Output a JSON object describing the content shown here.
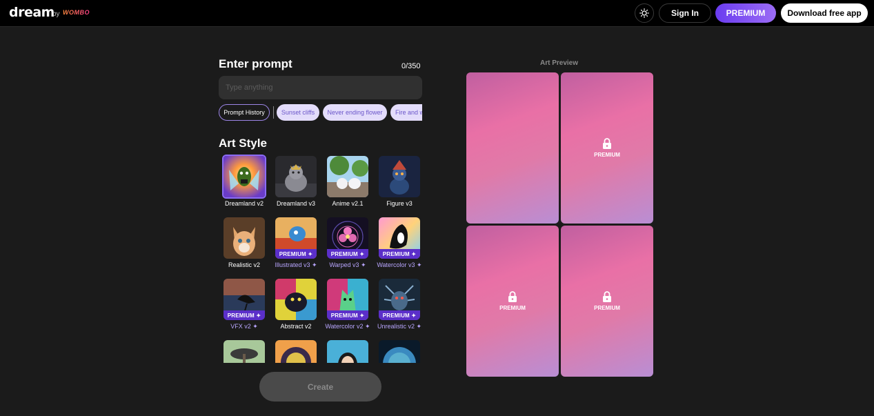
{
  "header": {
    "logo": "dream",
    "by": "by",
    "brand": "WOMBO",
    "signin_label": "Sign In",
    "premium_label": "PREMIUM",
    "download_label": "Download free app"
  },
  "prompt": {
    "title": "Enter prompt",
    "char_count": "0/350",
    "placeholder": "Type anything",
    "history_label": "Prompt History",
    "suggestions": [
      "Sunset cliffs",
      "Never ending flower",
      "Fire and w"
    ]
  },
  "art_style": {
    "title": "Art Style",
    "badge_label": "PREMIUM ✦",
    "styles": [
      {
        "label": "Dreamland v2",
        "premium": false,
        "selected": true
      },
      {
        "label": "Dreamland v3",
        "premium": false
      },
      {
        "label": "Anime v2.1",
        "premium": false
      },
      {
        "label": "Figure v3",
        "premium": false
      },
      {
        "label": "Realistic v2",
        "premium": false
      },
      {
        "label": "Illustrated v3 ✦",
        "premium": true
      },
      {
        "label": "Warped v3 ✦",
        "premium": true
      },
      {
        "label": "Watercolor v3 ✦",
        "premium": true
      },
      {
        "label": "VFX v2 ✦",
        "premium": true
      },
      {
        "label": "Abstract v2",
        "premium": false
      },
      {
        "label": "Watercolor v2 ✦",
        "premium": true
      },
      {
        "label": "Unrealistic v2 ✦",
        "premium": true
      }
    ]
  },
  "create_label": "Create",
  "preview": {
    "title": "Art Preview",
    "card_label": "PREMIUM"
  },
  "colors": {
    "accent": "#6a3cf0",
    "background": "#1b1b1b",
    "badge": "#5b2fc9"
  }
}
